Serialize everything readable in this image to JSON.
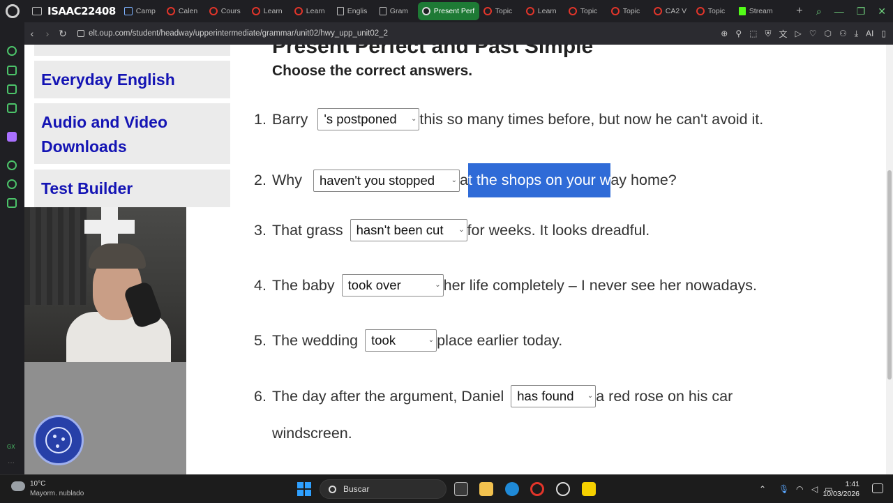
{
  "browser": {
    "user_name": "ISAAC22408",
    "tabs": [
      {
        "label": "Camp",
        "fav": "m"
      },
      {
        "label": "Calen",
        "fav": "r"
      },
      {
        "label": "Cours",
        "fav": "r"
      },
      {
        "label": "Learn",
        "fav": "r"
      },
      {
        "label": "Learn",
        "fav": "r"
      },
      {
        "label": "Englis",
        "fav": "doc"
      },
      {
        "label": "Gram",
        "fav": "doc"
      },
      {
        "label": "Present Perf",
        "fav": "oup",
        "active": true
      },
      {
        "label": "Topic",
        "fav": "r"
      },
      {
        "label": "Learn",
        "fav": "r"
      },
      {
        "label": "Topic",
        "fav": "r"
      },
      {
        "label": "Topic",
        "fav": "r"
      },
      {
        "label": "CA2 V",
        "fav": "r"
      },
      {
        "label": "Topic",
        "fav": "r"
      },
      {
        "label": "Stream",
        "fav": "kick"
      }
    ],
    "url": "elt.oup.com/student/headway/upperintermediate/grammar/unit02/hwy_upp_unit02_2",
    "ai_label": "AI"
  },
  "page": {
    "heading": "Present Perfect and Past Simple",
    "instruction": "Choose the correct answers.",
    "nav": {
      "everyday_english": "Everyday English",
      "audio_video": "Audio and Video Downloads",
      "test_builder": "Test Builder"
    },
    "questions": [
      {
        "num": "1.",
        "before": "Barry",
        "answer": "'s postponed",
        "after": "this so many times before, but now he can't avoid it."
      },
      {
        "num": "2.",
        "before": "Why",
        "answer": "haven't you stopped",
        "after_pre": "a",
        "after_hl": "t the shops on your w",
        "after_post": "ay home?"
      },
      {
        "num": "3.",
        "before": "That grass",
        "answer": "hasn't been cut",
        "after": "for weeks. It looks dreadful."
      },
      {
        "num": "4.",
        "before": "The baby",
        "answer": "took over",
        "after": "her life completely – I never see her nowadays."
      },
      {
        "num": "5.",
        "before": "The wedding",
        "answer": "took",
        "after": "place earlier today."
      },
      {
        "num": "6.",
        "before": "The day after the argument, Daniel",
        "answer": "has found",
        "after": "a red rose on his car",
        "after_line2": "windscreen."
      }
    ]
  },
  "taskbar": {
    "weather_temp": "10°C",
    "weather_desc": "Mayorm. nublado",
    "search_label": "Buscar",
    "time": "1:41",
    "date": "10/03/2026"
  },
  "colors": {
    "link_blue": "#1414b4",
    "highlight": "#2f6bd7",
    "active_tab": "#1e7a35",
    "cookie_blue": "#2740a8"
  }
}
